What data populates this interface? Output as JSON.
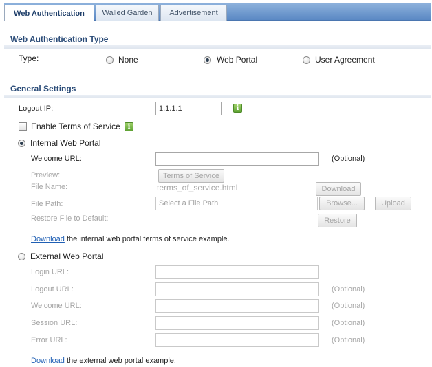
{
  "tabs": [
    {
      "label": "Web Authentication",
      "active": true
    },
    {
      "label": "Walled Garden",
      "active": false
    },
    {
      "label": "Advertisement",
      "active": false
    }
  ],
  "auth_type": {
    "section_title": "Web Authentication Type",
    "type_label": "Type:",
    "options": [
      {
        "label": "None",
        "checked": false
      },
      {
        "label": "Web Portal",
        "checked": true
      },
      {
        "label": "User Agreement",
        "checked": false
      }
    ]
  },
  "general": {
    "section_title": "General Settings",
    "logout_ip_label": "Logout IP:",
    "logout_ip_value": "1.1.1.1",
    "info_glyph": "i",
    "enable_tos_label": "Enable Terms of Service",
    "internal": {
      "label": "Internal Web Portal",
      "welcome_url_label": "Welcome URL:",
      "welcome_url_value": "",
      "optional_label": "(Optional)",
      "preview_label": "Preview:",
      "tos_button": "Terms of Service",
      "file_name_label": "File Name:",
      "file_name_value": "terms_of_service.html",
      "download_button": "Download",
      "file_path_label": "File Path:",
      "file_path_placeholder": "Select a File Path",
      "browse_button": "Browse...",
      "upload_button": "Upload",
      "restore_label": "Restore File to Default:",
      "restore_button": "Restore",
      "download_link": "Download",
      "download_text": " the internal web portal terms of service example."
    },
    "external": {
      "label": "External Web Portal",
      "login_url_label": "Login URL:",
      "logout_url_label": "Logout URL:",
      "welcome_url_label": "Welcome URL:",
      "session_url_label": "Session URL:",
      "error_url_label": "Error URL:",
      "optional_label": "(Optional)",
      "download_link": "Download",
      "download_text": " the external web portal example."
    }
  }
}
